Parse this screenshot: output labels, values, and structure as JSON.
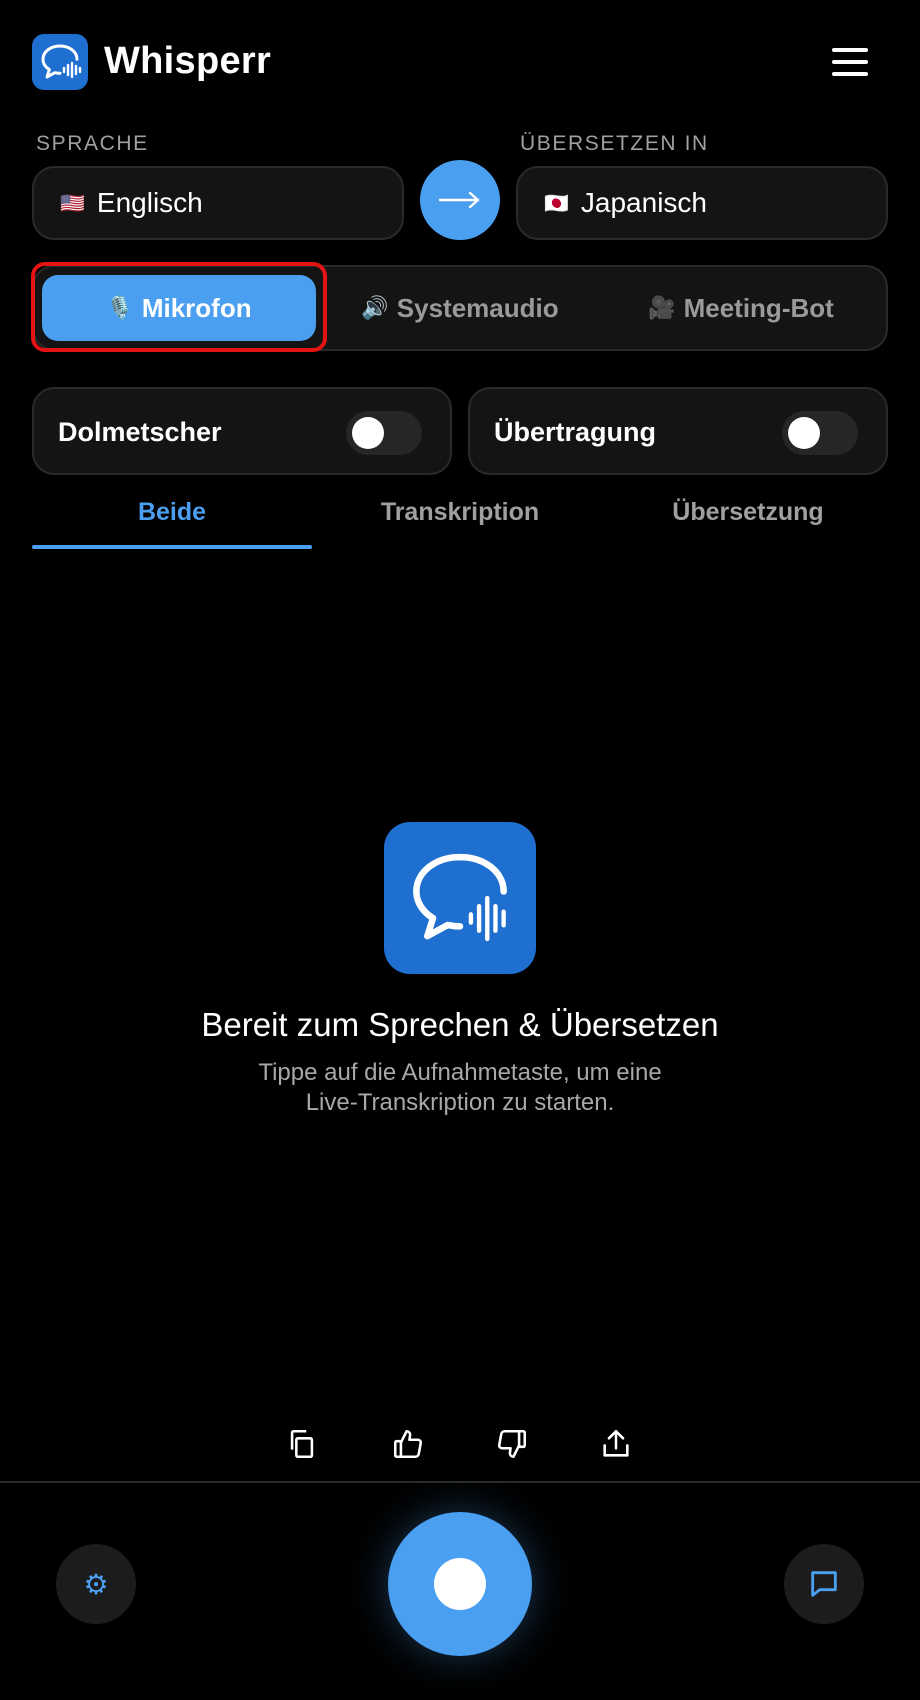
{
  "app": {
    "title": "Whisperr",
    "logo_icon": "speech-bubble-waveform-icon"
  },
  "colors": {
    "accent": "#4a9ff0",
    "logo_bg": "#1f6fd0",
    "highlight": "#e51414",
    "background": "#000000"
  },
  "language": {
    "source_label": "SPRACHE",
    "source_flag": "🇺🇸",
    "source_value": "Englisch",
    "target_label": "ÜBERSETZEN IN",
    "target_flag": "🇯🇵",
    "target_value": "Japanisch",
    "swap_icon": "arrow-right-icon"
  },
  "sources": [
    {
      "icon": "🎙️",
      "label": "Mikrofon",
      "active": true
    },
    {
      "icon": "🔊",
      "label": "Systemaudio",
      "active": false
    },
    {
      "icon": "🎥",
      "label": "Meeting-Bot",
      "active": false
    }
  ],
  "toggles": [
    {
      "label": "Dolmetscher",
      "on": false
    },
    {
      "label": "Übertragung",
      "on": false
    }
  ],
  "tabs": [
    {
      "label": "Beide",
      "active": true
    },
    {
      "label": "Transkription",
      "active": false
    },
    {
      "label": "Übersetzung",
      "active": false
    }
  ],
  "empty_state": {
    "title": "Bereit zum Sprechen & Übersetzen",
    "subtitle_line1": "Tippe auf die Aufnahmetaste, um eine",
    "subtitle_line2": "Live-Transkription zu starten."
  },
  "actions": [
    "copy-icon",
    "thumbs-up-icon",
    "thumbs-down-icon",
    "share-icon"
  ],
  "bottom": {
    "settings_icon": "⚙",
    "chat_icon": "chat-bubble-icon",
    "record_icon": "record-icon"
  }
}
